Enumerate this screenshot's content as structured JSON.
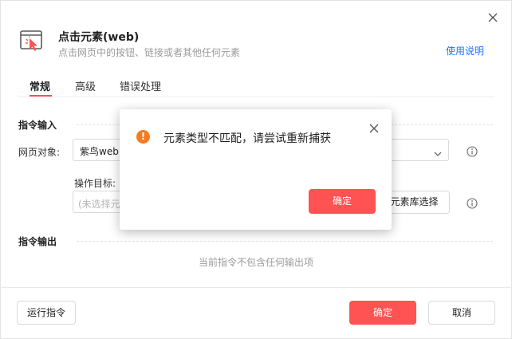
{
  "header": {
    "title": "点击元素(web)",
    "subtitle": "点击网页中的按钮、链接或者其他任何元素",
    "help_link": "使用说明",
    "icons": {
      "app": "click-cursor-icon",
      "close": "close-icon"
    }
  },
  "tabs": [
    {
      "label": "常规",
      "active": true
    },
    {
      "label": "高级",
      "active": false
    },
    {
      "label": "错误处理",
      "active": false
    }
  ],
  "input_section": {
    "title": "指令输入",
    "web_object_label": "网页对象:",
    "web_object_value": "紫鸟web",
    "target_label": "操作目标:",
    "target_placeholder": "(未选择元",
    "element_lib_button": "元素库选择"
  },
  "output_section": {
    "title": "指令输出",
    "empty_text": "当前指令不包含任何输出项"
  },
  "footer": {
    "run_button": "运行指令",
    "confirm_button": "确定",
    "cancel_button": "取消"
  },
  "modal": {
    "message": "元素类型不匹配，请尝试重新捕获",
    "confirm_button": "确定",
    "icon": "warning-icon"
  },
  "colors": {
    "accent": "#ff5252",
    "link": "#1677ff",
    "warning": "#f47c20"
  }
}
